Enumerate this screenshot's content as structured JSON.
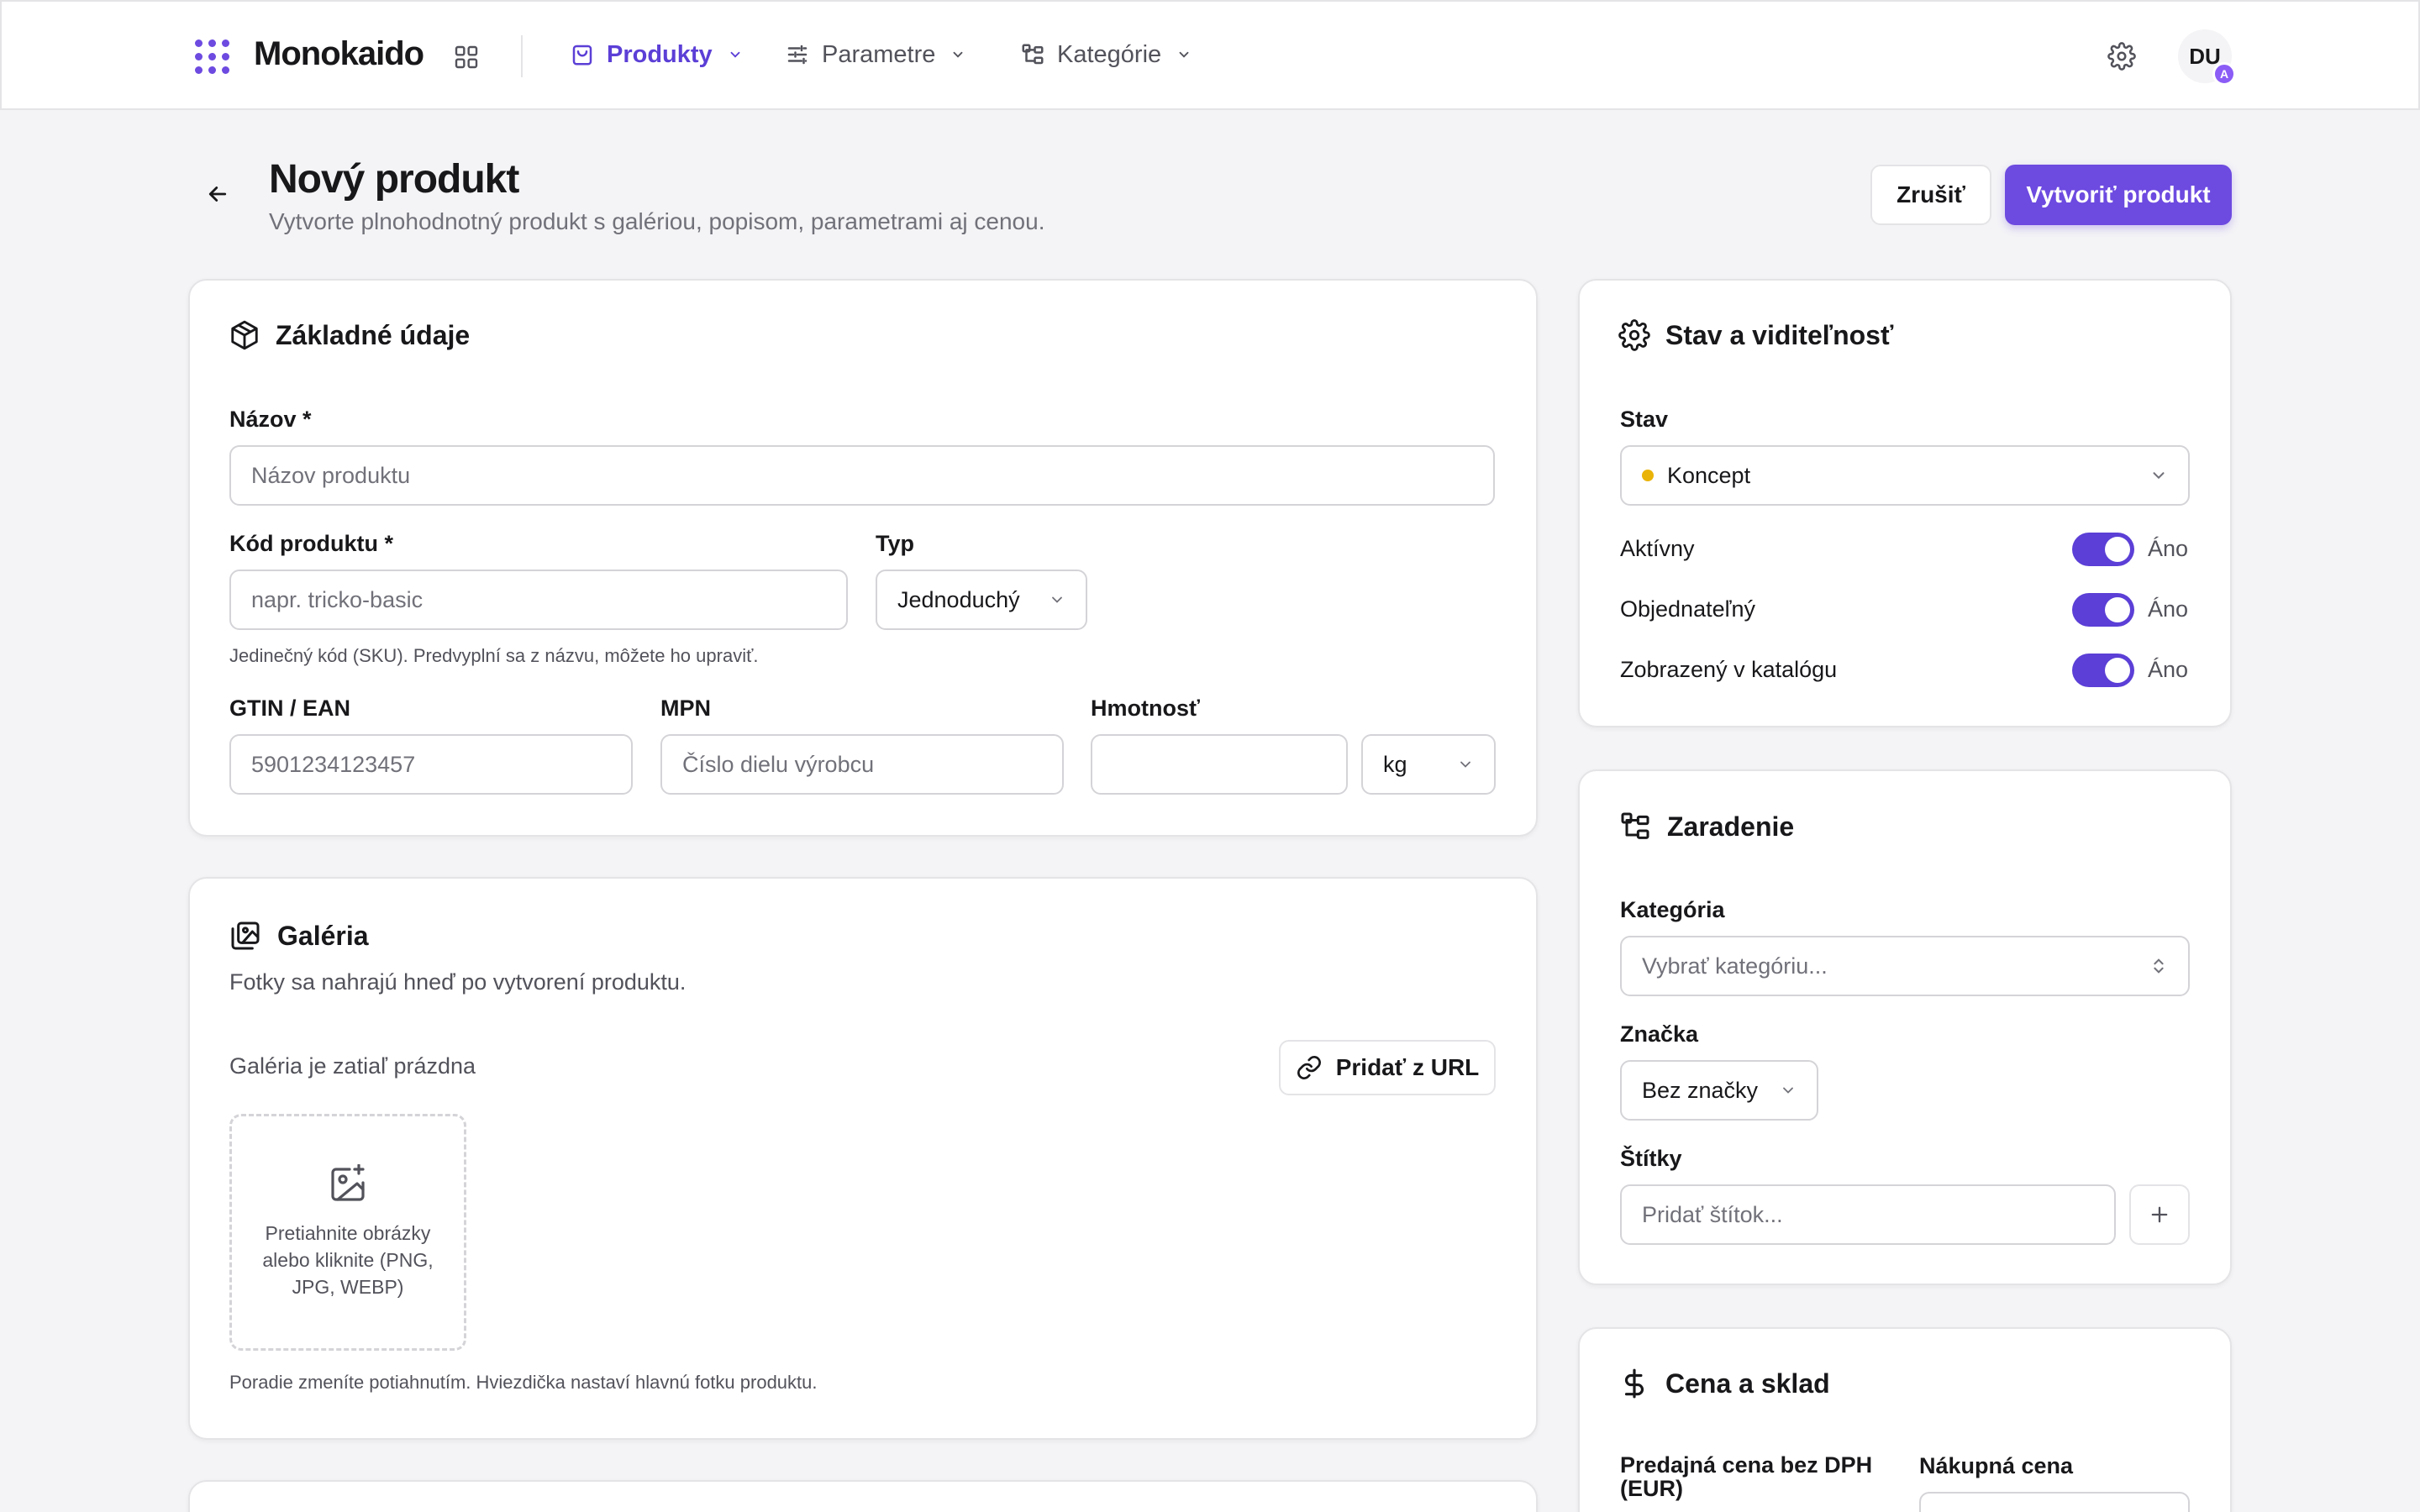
{
  "app": {
    "brand": "Monokaido",
    "accent_color": "#6d4ae0"
  },
  "nav": {
    "items": [
      {
        "label": "Produkty",
        "icon": "shopping-bag-icon",
        "active": true
      },
      {
        "label": "Parametre",
        "icon": "sliders-icon",
        "active": false
      },
      {
        "label": "Kategórie",
        "icon": "category-tree-icon",
        "active": false
      }
    ],
    "avatar_initials": "DU",
    "avatar_badge": "A"
  },
  "header": {
    "title": "Nový produkt",
    "subtitle": "Vytvorte plnohodnotný produkt s galériou, popisom, parametrami aj cenou.",
    "cancel_label": "Zrušiť",
    "create_label": "Vytvoriť produkt"
  },
  "basic": {
    "title": "Základné údaje",
    "name_label": "Názov *",
    "name_placeholder": "Názov produktu",
    "code_label": "Kód produktu *",
    "code_placeholder": "napr. tricko-basic",
    "type_label": "Typ",
    "type_value": "Jednoduchý",
    "code_help": "Jedinečný kód (SKU). Predvyplní sa z názvu, môžete ho upraviť.",
    "gtin_label": "GTIN / EAN",
    "gtin_placeholder": "5901234123457",
    "mpn_label": "MPN",
    "mpn_placeholder": "Číslo dielu výrobcu",
    "weight_label": "Hmotnosť",
    "weight_value": "",
    "weight_unit": "kg"
  },
  "gallery": {
    "title": "Galéria",
    "subtitle": "Fotky sa nahrajú hneď po vytvorení produktu.",
    "empty_text": "Galéria je zatiaľ prázdna",
    "add_url_label": "Pridať z URL",
    "dropzone_text": "Pretiahnite obrázky alebo kliknite (PNG, JPG, WEBP)",
    "footer_help": "Poradie zmeníte potiahnutím. Hviezdička nastaví hlavnú fotku produktu."
  },
  "status": {
    "title": "Stav a viditeľnosť",
    "state_label": "Stav",
    "state_value": "Koncept",
    "state_color": "#eab308",
    "toggles": [
      {
        "label": "Aktívny",
        "value": "Áno",
        "on": true
      },
      {
        "label": "Objednateľný",
        "value": "Áno",
        "on": true
      },
      {
        "label": "Zobrazený v katalógu",
        "value": "Áno",
        "on": true
      }
    ]
  },
  "classification": {
    "title": "Zaradenie",
    "category_label": "Kategória",
    "category_placeholder": "Vybrať kategóriu...",
    "brand_label": "Značka",
    "brand_value": "Bez značky",
    "tags_label": "Štítky",
    "tags_placeholder": "Pridať štítok..."
  },
  "pricing": {
    "title": "Cena a sklad",
    "sale_price_label": "Predajná cena bez DPH (EUR)",
    "purchase_price_label": "Nákupná cena"
  }
}
